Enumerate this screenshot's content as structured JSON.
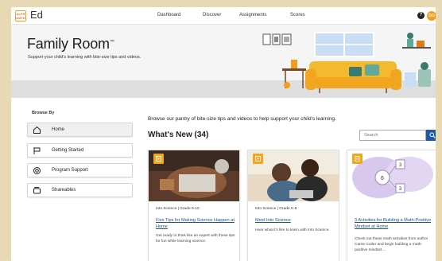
{
  "colors": {
    "accent": "#f2a51f",
    "link": "#1f4fa0",
    "search_button": "#1f5aa8"
  },
  "topnav": {
    "logo_text": "ALPS\nMATH",
    "brand": "Ed",
    "links": [
      "Dashboard",
      "Discover",
      "Assignments",
      "Scores"
    ],
    "help_icon": "?",
    "avatar_initials": "DO"
  },
  "banner": {
    "title": "Family Room",
    "trademark": "™",
    "subtitle": "Support your child's learning with bite-size tips and videos."
  },
  "sidebar": {
    "heading": "Browse By",
    "items": [
      {
        "label": "Home",
        "icon": "home-icon",
        "active": true
      },
      {
        "label": "Getting Started",
        "icon": "flag-icon",
        "active": false
      },
      {
        "label": "Program Support",
        "icon": "support-icon",
        "active": false
      },
      {
        "label": "Shareables",
        "icon": "share-icon",
        "active": false
      }
    ]
  },
  "main": {
    "intro": "Browse our pantry of bite-size tips and videos to help support your child's learning.",
    "section_title": "What's New (34)",
    "search": {
      "placeholder": "Search",
      "icon": "search-icon"
    },
    "cards": [
      {
        "badge_icon": "video-icon",
        "meta": "Into Science | Grade 6-12",
        "title": "Five Tips for Making Science Happen at Home",
        "description": "Get ready to think like an expert with these tips for fun while learning science."
      },
      {
        "badge_icon": "video-icon",
        "meta": "Into Science | Grade K-8",
        "title": "Meet Into Science",
        "description": "Hear what it's like to learn with Into Science."
      },
      {
        "badge_icon": "document-icon",
        "meta": "",
        "title": "3 Activities for Building a Math-Positive Mindset at Home",
        "description": "Check out these math activities from author Carrie Cutler and begin building a math-positive mindset...."
      }
    ]
  }
}
